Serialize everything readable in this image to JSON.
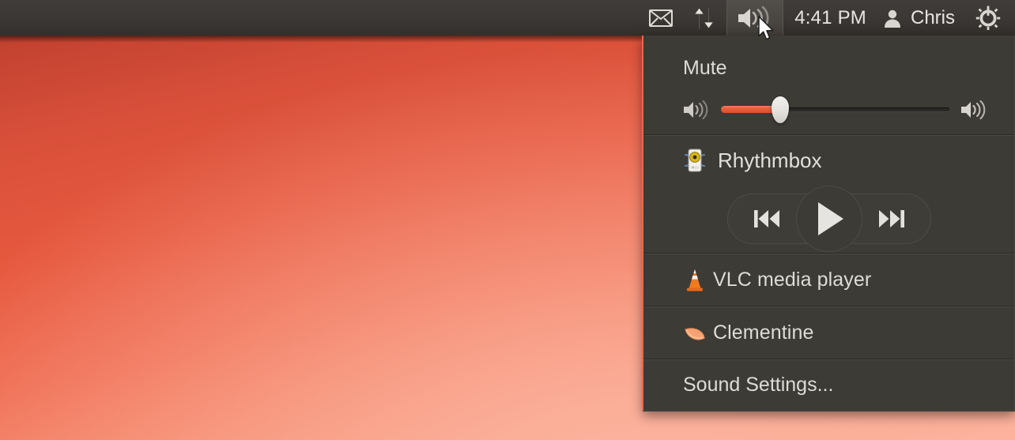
{
  "panel": {
    "items": [
      {
        "name": "mail-icon",
        "label": "",
        "icon": "envelope-icon"
      },
      {
        "name": "sync-icon",
        "label": "",
        "icon": "up-down-arrows-icon"
      },
      {
        "name": "sound-icon",
        "label": "",
        "icon": "speaker-volume-icon",
        "active": true
      }
    ],
    "clock": "4:41 PM",
    "user": "Chris",
    "session_icon": "gear-power-icon"
  },
  "menu": {
    "mute_label": "Mute",
    "volume": {
      "low_icon": "speaker-low-icon",
      "high_icon": "speaker-high-icon",
      "value_percent": 26,
      "min": 0,
      "max": 100
    },
    "player": {
      "icon": "rhythmbox-icon",
      "name": "Rhythmbox",
      "previous_label": "previous-track-icon",
      "play_label": "play-icon",
      "next_label": "next-track-icon"
    },
    "apps": [
      {
        "icon": "vlc-cone-icon",
        "label": "VLC media player"
      },
      {
        "icon": "clementine-icon",
        "label": "Clementine"
      }
    ],
    "settings_label": "Sound Settings..."
  },
  "colors": {
    "accent": "#e8684a",
    "panel_bg": "#3b3835",
    "menu_bg": "#3c3b36",
    "text": "#dedcd8",
    "slider_fill": "#e35c36"
  }
}
